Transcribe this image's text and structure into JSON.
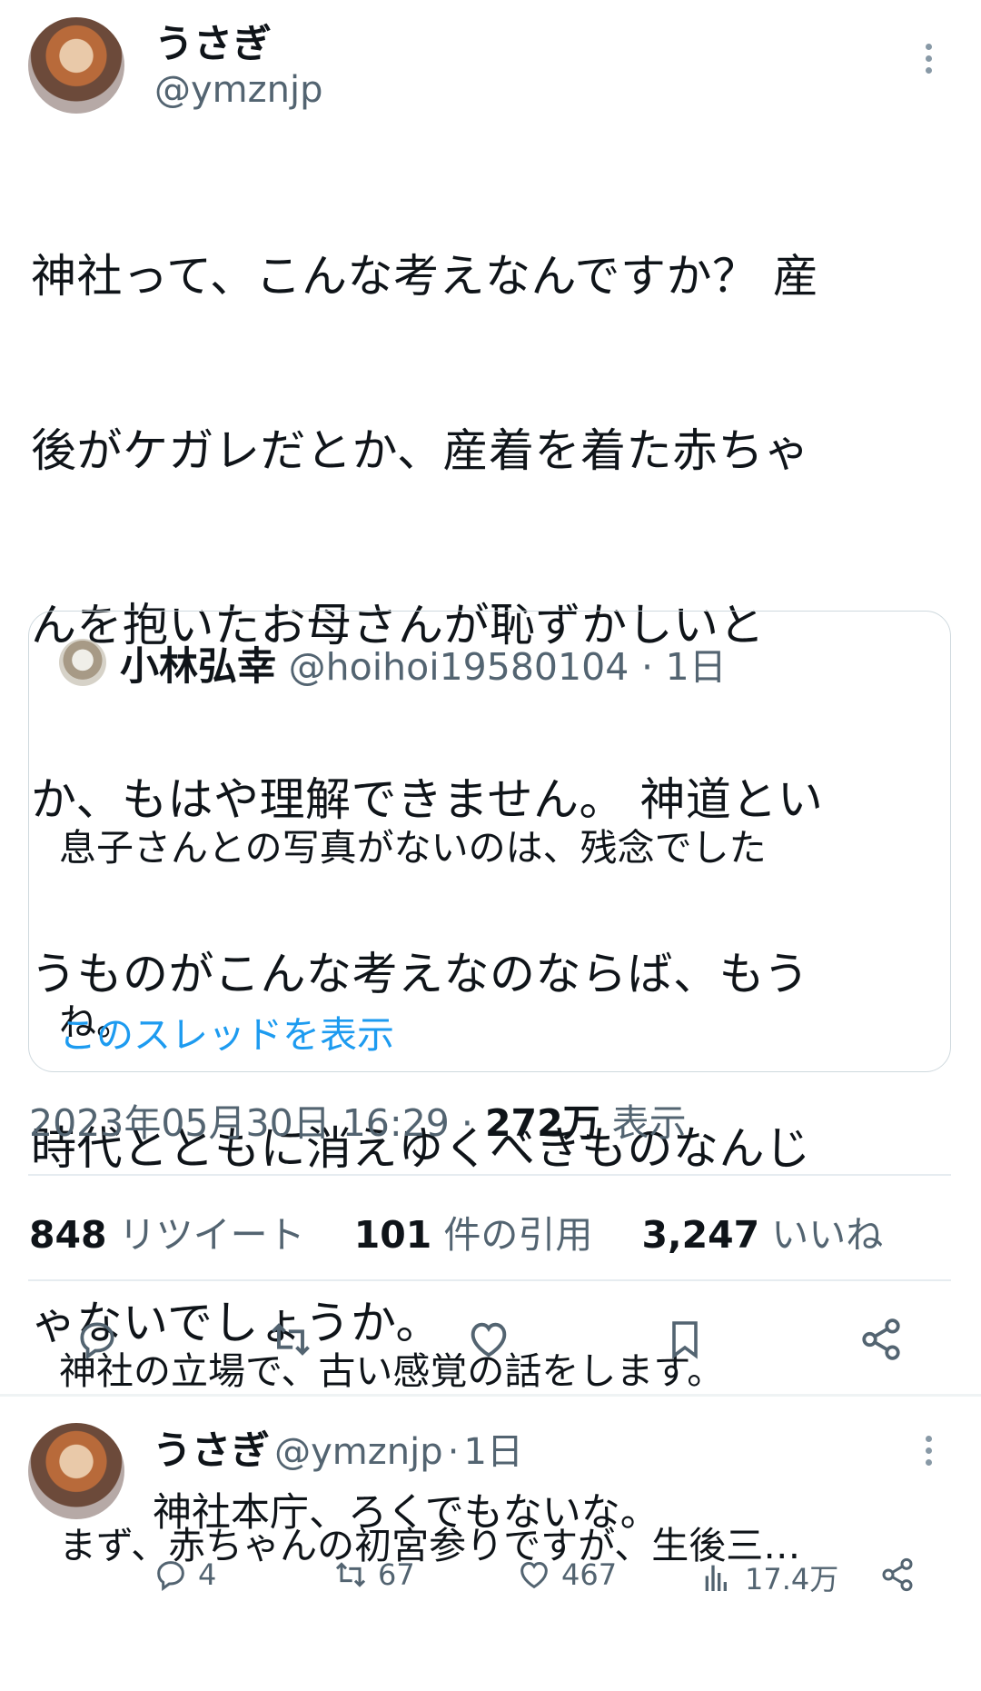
{
  "main_tweet": {
    "author_name": "うさぎ",
    "author_handle": "@ymznjp",
    "text_lines": [
      "神社って、こんな考えなんですか？ 産",
      "後がケガレだとか、産着を着た赤ちゃ",
      "んを抱いたお母さんが恥ずかしいと",
      "か、もはや理解できません。 神道とい",
      "うものがこんな考えなのならば、もう",
      "時代とともに消えゆくべきものなんじ",
      "ゃないでしょうか。"
    ],
    "timestamp": "2023年05月30日 16:29",
    "views_count": "272万",
    "views_label": "表示"
  },
  "quote": {
    "author_name": "小林弘幸",
    "author_handle": "@hoihoi19580104",
    "time": "1日",
    "text_lines": [
      "息子さんとの写真がないのは、残念でした",
      "ね。",
      "",
      "神社の立場で、古い感覚の話をします。",
      "まず、赤ちゃんの初宮参りですが、生後三…"
    ],
    "show_thread": "このスレッドを表示"
  },
  "stats": {
    "retweets_count": "848",
    "retweets_label": "リツイート",
    "quotes_count": "101",
    "quotes_label": "件の引用",
    "likes_count": "3,247",
    "likes_label": "いいね"
  },
  "actions": [
    "reply-icon",
    "retweet-icon",
    "like-icon",
    "bookmark-icon",
    "share-icon"
  ],
  "reply_tweet": {
    "author_name": "うさぎ",
    "author_handle": "@ymznjp",
    "time": "1日",
    "text": "神社本庁、ろくでもないな。",
    "replies": "4",
    "retweets": "67",
    "likes": "467",
    "views": "17.4万"
  },
  "colors": {
    "accent": "#1d9bf0",
    "secondary_text": "#536471",
    "border": "#cfd9de"
  }
}
